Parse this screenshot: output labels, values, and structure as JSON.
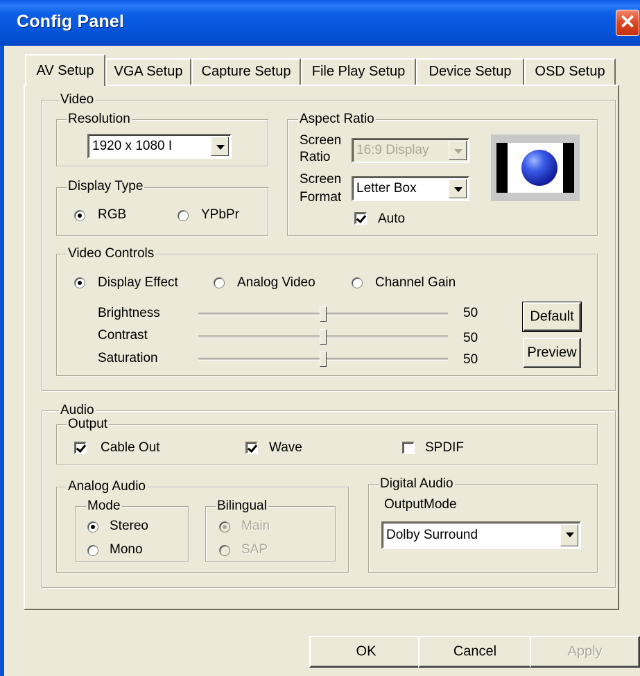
{
  "window": {
    "title": "Config Panel",
    "close_symbol": "✕"
  },
  "tabs": [
    {
      "label": "AV Setup",
      "active": true
    },
    {
      "label": "VGA Setup"
    },
    {
      "label": "Capture Setup"
    },
    {
      "label": "File Play Setup"
    },
    {
      "label": "Device Setup"
    },
    {
      "label": "OSD Setup"
    }
  ],
  "video": {
    "group_label": "Video",
    "resolution": {
      "group_label": "Resolution",
      "value": "1920 x 1080 I"
    },
    "display_type": {
      "group_label": "Display Type",
      "options": [
        "RGB",
        "YPbPr"
      ],
      "selected": "RGB"
    },
    "aspect_ratio": {
      "group_label": "Aspect Ratio",
      "screen_ratio_label_1": "Screen",
      "screen_ratio_label_2": "Ratio",
      "screen_ratio_value": "16:9 Display",
      "screen_format_label_1": "Screen",
      "screen_format_label_2": "Format",
      "screen_format_value": "Letter Box",
      "auto_label": "Auto",
      "auto_checked": true
    },
    "controls": {
      "group_label": "Video Controls",
      "modes": [
        "Display Effect",
        "Analog Video",
        "Channel Gain"
      ],
      "selected_mode": "Display Effect",
      "sliders": [
        {
          "label": "Brightness",
          "value": "50"
        },
        {
          "label": "Contrast",
          "value": "50"
        },
        {
          "label": "Saturation",
          "value": "50"
        }
      ],
      "default_button": "Default",
      "preview_button": "Preview"
    }
  },
  "audio": {
    "group_label": "Audio",
    "output": {
      "group_label": "Output",
      "items": [
        {
          "label": "Cable Out",
          "checked": true
        },
        {
          "label": "Wave",
          "checked": true
        },
        {
          "label": "SPDIF",
          "checked": false
        }
      ]
    },
    "analog": {
      "group_label": "Analog Audio",
      "mode": {
        "group_label": "Mode",
        "options": [
          "Stereo",
          "Mono"
        ],
        "selected": "Stereo"
      },
      "bilingual": {
        "group_label": "Bilingual",
        "options": [
          "Main",
          "SAP"
        ],
        "selected": "Main",
        "disabled": true
      }
    },
    "digital": {
      "group_label": "Digital Audio",
      "output_mode_label": "OutputMode",
      "output_mode_value": "Dolby Surround"
    }
  },
  "buttons": {
    "ok": "OK",
    "cancel": "Cancel",
    "apply": "Apply"
  },
  "colors": {
    "title_bar": "#0553D8",
    "dialog_face": "#ECE9D8",
    "close_button": "#D8421C"
  }
}
